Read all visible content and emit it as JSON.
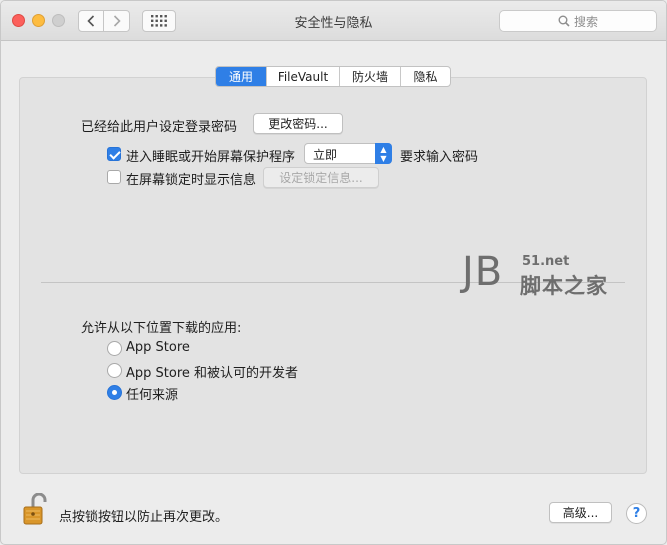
{
  "window": {
    "title": "安全性与隐私"
  },
  "toolbar": {
    "search_placeholder": "搜索"
  },
  "tabs": [
    {
      "label": "通用",
      "active": true
    },
    {
      "label": "FileVault",
      "active": false
    },
    {
      "label": "防火墙",
      "active": false
    },
    {
      "label": "隐私",
      "active": false
    }
  ],
  "general": {
    "password_set_label": "已经给此用户设定登录密码",
    "change_password_button": "更改密码...",
    "require_password": {
      "checked": true,
      "label": "进入睡眠或开始屏幕保护程序",
      "select_value": "立即",
      "suffix": "要求输入密码"
    },
    "show_message": {
      "checked": false,
      "label": "在屏幕锁定时显示信息",
      "button": "设定锁定信息..."
    },
    "download_label": "允许从以下位置下载的应用:",
    "download_options": [
      {
        "label": "App Store",
        "selected": false
      },
      {
        "label": "App Store 和被认可的开发者",
        "selected": false
      },
      {
        "label": "任何来源",
        "selected": true
      }
    ]
  },
  "watermark": {
    "jb": "JB",
    "site": "51.net",
    "name": "脚本之家"
  },
  "footer": {
    "lock_text": "点按锁按钮以防止再次更改。",
    "advanced_button": "高级...",
    "help_label": "?"
  },
  "colors": {
    "accent": "#2f7fe6",
    "lock": "#d9962a"
  }
}
